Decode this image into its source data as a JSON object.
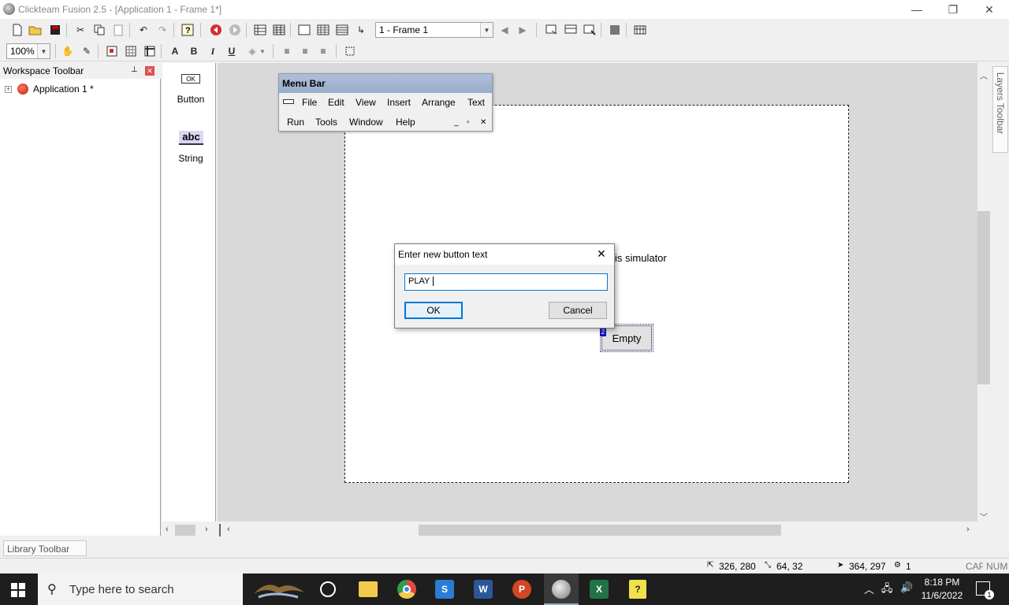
{
  "window": {
    "title": "Clickteam Fusion 2.5 - [Application 1 - Frame 1*]",
    "minimize": "—",
    "restore": "❐",
    "close": "✕"
  },
  "toolbar": {
    "frame_combo": "1 - Frame 1",
    "zoom_combo": "100%",
    "icons": [
      "new-icon",
      "open-icon",
      "save-icon",
      "cut-icon",
      "copy-icon",
      "paste-icon",
      "undo-icon",
      "redo-icon",
      "help-icon",
      "back-icon",
      "forward-icon",
      "storyboard-icon",
      "frame-editor-icon",
      "event-editor-icon",
      "event-list-icon",
      "data-elements-icon",
      "prev-frame-icon",
      "next-frame-icon",
      "run-application-icon",
      "run-frame-icon",
      "build-icon",
      "stop-icon",
      "preferences-icon"
    ],
    "format": {
      "bold": "B",
      "italic": "I",
      "underline": "U"
    }
  },
  "workspace": {
    "title": "Workspace Toolbar",
    "pin": "📌",
    "close": "✕",
    "tree": [
      {
        "label": "Application 1 *",
        "expander": "+"
      }
    ]
  },
  "objects": [
    {
      "label": "Button",
      "icon_text": "OK"
    },
    {
      "label": "String",
      "icon_text": "abc"
    }
  ],
  "menubar_window": {
    "title": "Menu Bar",
    "row1": [
      "File",
      "Edit",
      "View",
      "Insert",
      "Arrange",
      "Text"
    ],
    "row2": [
      "Run",
      "Tools",
      "Window",
      "Help"
    ]
  },
  "frame": {
    "text_fragment": "is simulator",
    "button_label": "Empty",
    "button_badge": "2"
  },
  "dialog": {
    "title": "Enter new button text",
    "close": "✕",
    "value": "PLAY ",
    "ok": "OK",
    "cancel": "Cancel"
  },
  "layers_toolbar": "Layers Toolbar",
  "library_toolbar": "Library Toolbar",
  "status": {
    "size": "326, 280",
    "dims": "64, 32",
    "cursor": "364, 297",
    "count": "1",
    "cap": "CAP",
    "num": "NUM"
  },
  "taskbar": {
    "search_placeholder": "Type here to search",
    "time": "8:18 PM",
    "date": "11/6/2022",
    "notifications": "1",
    "colors": {
      "chrome": "#dd4b3a",
      "explorer": "#f2c94c",
      "word": "#2b579a",
      "powerpoint": "#d24726",
      "excel": "#217346"
    }
  }
}
